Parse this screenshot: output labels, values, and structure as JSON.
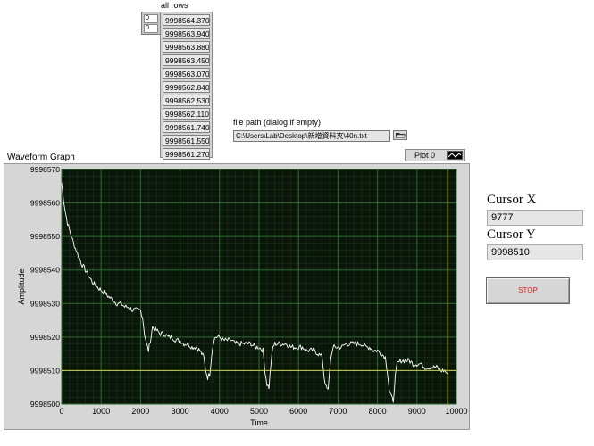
{
  "all_rows": {
    "label": "all rows",
    "indices": [
      "0",
      "0"
    ],
    "values": [
      "9998564.370",
      "9998563.940",
      "9998563.880",
      "9998563.450",
      "9998563.070",
      "9998562.840",
      "9998562.530",
      "9998562.110",
      "9998561.740",
      "9998561.550",
      "9998561.270"
    ]
  },
  "file_path": {
    "label": "file path (dialog if empty)",
    "value": "C:\\Users\\Lab\\Desktop\\新增資料夾\\40n.txt",
    "browse_icon": "folder-icon"
  },
  "waveform_graph": {
    "label": "Waveform Graph",
    "plot_legend": "Plot 0",
    "colors": {
      "plot_bg": "#0b160b",
      "grid": "#2f6a2f",
      "trace": "#ffffff",
      "cursor": "#c8c850",
      "frame": "#d6d6d6"
    }
  },
  "cursor_x": {
    "label": "Cursor X",
    "value": "9777"
  },
  "cursor_y": {
    "label": "Cursor Y",
    "value": "9998510"
  },
  "stop_button": {
    "label": "STOP"
  },
  "chart_data": {
    "type": "line",
    "xlabel": "Time",
    "ylabel": "Amplitude",
    "xlim": [
      0,
      10000
    ],
    "ylim": [
      9998500,
      9998570
    ],
    "xticks": [
      0,
      1000,
      2000,
      3000,
      4000,
      5000,
      6000,
      7000,
      8000,
      9000,
      10000
    ],
    "yticks": [
      9998500,
      9998510,
      9998520,
      9998530,
      9998540,
      9998550,
      9998560,
      9998570
    ],
    "ytick_labels": [
      "9998500",
      "9998510",
      "9998520",
      "9998530",
      "9998540",
      "9998550",
      "9998560",
      "9998570"
    ],
    "grid": true,
    "cursor": {
      "x": 9777,
      "y": 9998510
    },
    "series": [
      {
        "x": [
          0,
          50,
          100,
          150,
          200,
          300,
          400,
          500,
          600,
          700,
          800,
          900,
          1000,
          1100,
          1200,
          1300,
          1400,
          1500,
          1600,
          1700,
          1800,
          1900,
          2000,
          2050,
          2100,
          2150,
          2200,
          2250,
          2300,
          2400,
          2500,
          2600,
          2700,
          2800,
          2900,
          3000,
          3100,
          3200,
          3300,
          3400,
          3500,
          3600,
          3650,
          3700,
          3750,
          3800,
          3850,
          3900,
          4000,
          4100,
          4200,
          4300,
          4400,
          4500,
          4600,
          4700,
          4800,
          4900,
          5000,
          5100,
          5150,
          5200,
          5250,
          5300,
          5350,
          5400,
          5500,
          5600,
          5700,
          5800,
          5900,
          6000,
          6100,
          6200,
          6300,
          6400,
          6500,
          6600,
          6650,
          6700,
          6750,
          6800,
          6850,
          6900,
          7000,
          7100,
          7200,
          7300,
          7400,
          7500,
          7600,
          7700,
          7800,
          7900,
          8000,
          8100,
          8200,
          8250,
          8300,
          8350,
          8400,
          8450,
          8500,
          8600,
          8700,
          8800,
          8900,
          9000,
          9100,
          9200,
          9300,
          9400,
          9500,
          9600,
          9700,
          9777
        ],
        "y": [
          9998566,
          9998561,
          9998557,
          9998554,
          9998552,
          9998548,
          9998545,
          9998542,
          9998540,
          9998538,
          9998536,
          9998535,
          9998534,
          9998533,
          9998532,
          9998531,
          9998530,
          9998530,
          9998529,
          9998529,
          9998528,
          9998528,
          9998528,
          9998526,
          9998521,
          9998518,
          9998516,
          9998519,
          9998523,
          9998522,
          9998521,
          9998521,
          9998520,
          9998520,
          9998519,
          9998519,
          9998518,
          9998518,
          9998517,
          9998517,
          9998516,
          9998514,
          9998510,
          9998508,
          9998509,
          9998515,
          9998519,
          9998520,
          9998520,
          9998519,
          9998519,
          9998519,
          9998518,
          9998518,
          9998518,
          9998518,
          9998518,
          9998517,
          9998517,
          9998516,
          9998510,
          9998506,
          9998505,
          9998512,
          9998517,
          9998518,
          9998518,
          9998518,
          9998518,
          9998517,
          9998517,
          9998517,
          9998517,
          9998516,
          9998516,
          9998516,
          9998515,
          9998514,
          9998508,
          9998505,
          9998504,
          9998512,
          9998516,
          9998517,
          9998517,
          9998517,
          9998518,
          9998518,
          9998518,
          9998518,
          9998518,
          9998517,
          9998517,
          9998516,
          9998516,
          9998515,
          9998514,
          9998510,
          9998504,
          9998502,
          9998501,
          9998508,
          9998512,
          9998513,
          9998513,
          9998513,
          9998512,
          9998512,
          9998512,
          9998511,
          9998511,
          9998511,
          9998511,
          9998510,
          9998510,
          9998509
        ]
      }
    ]
  }
}
